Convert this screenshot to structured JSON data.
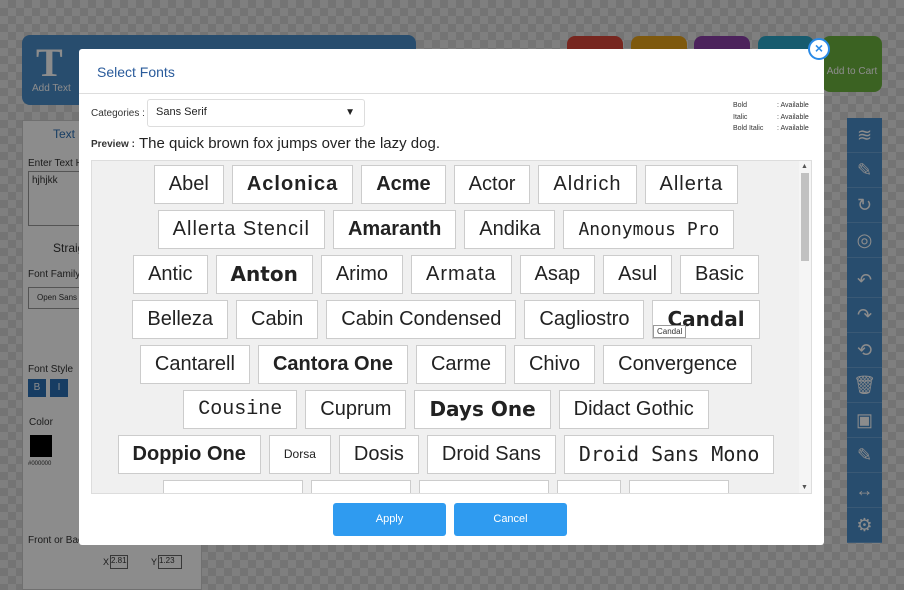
{
  "background": {
    "toolbar": {
      "add_text_icon": "T",
      "add_text_label": "Add Text"
    },
    "cart": {
      "label": "Add to Cart",
      "icon": "cart-icon"
    },
    "left_panel": {
      "tab": "Text",
      "enter_text_label": "Enter Text H",
      "text_value": "hjhjkk",
      "radio_label": "Straig",
      "font_family_label": "Font Family",
      "font_family_value": "Open Sans",
      "font_style_label": "Font Style",
      "styles": [
        "B",
        "I"
      ],
      "color_label": "Color",
      "color_value": "#000000",
      "front_back_label": "Front or Bac",
      "x_label": "X",
      "x_value": "2.81",
      "y_label": "Y",
      "y_value": "1.23",
      "unit": "in"
    },
    "right_tools": [
      "layers-icon",
      "edit-icon",
      "rotate-icon",
      "target-icon",
      "undo-icon",
      "redo-icon",
      "reset-icon",
      "trash-icon",
      "select-icon",
      "edit-icon",
      "ruler-icon",
      "gear-icon"
    ],
    "colors": {
      "accent": "#4a8cc9",
      "cart": "#6cb33f"
    }
  },
  "modal": {
    "title": "Select Fonts",
    "close_icon": "×",
    "categories_label": "Categories :",
    "category_value": "Sans Serif",
    "availability": [
      {
        "k": "Bold",
        "v": ": Available"
      },
      {
        "k": "Italic",
        "v": ": Available"
      },
      {
        "k": "Bold Italic",
        "v": ": Available"
      }
    ],
    "preview_label": "Preview :",
    "preview_text": "The quick brown fox jumps over the lazy dog.",
    "tooltip": "Candal",
    "font_rows": [
      [
        "Abel",
        "Aclonica",
        "Acme",
        "Actor",
        "Aldrich",
        "Allerta"
      ],
      [
        "Allerta Stencil",
        "Amaranth",
        "Andika",
        "Anonymous Pro"
      ],
      [
        "Antic",
        "Anton",
        "Arimo",
        "Armata",
        "Asap",
        "Asul",
        "Basic"
      ],
      [
        "Belleza",
        "Cabin",
        "Cabin Condensed",
        "Cagliostro",
        "Candal"
      ],
      [
        "Cantarell",
        "Cantora One",
        "Carme",
        "Chivo",
        "Convergence"
      ],
      [
        "Cousine",
        "Cuprum",
        "Days One",
        "Didact Gothic"
      ],
      [
        "Doppio One",
        "Dorsa",
        "Dosis",
        "Droid Sans",
        "Droid Sans Mono"
      ]
    ],
    "apply_label": "Apply",
    "cancel_label": "Cancel",
    "button_color": "#2f9bf0"
  }
}
